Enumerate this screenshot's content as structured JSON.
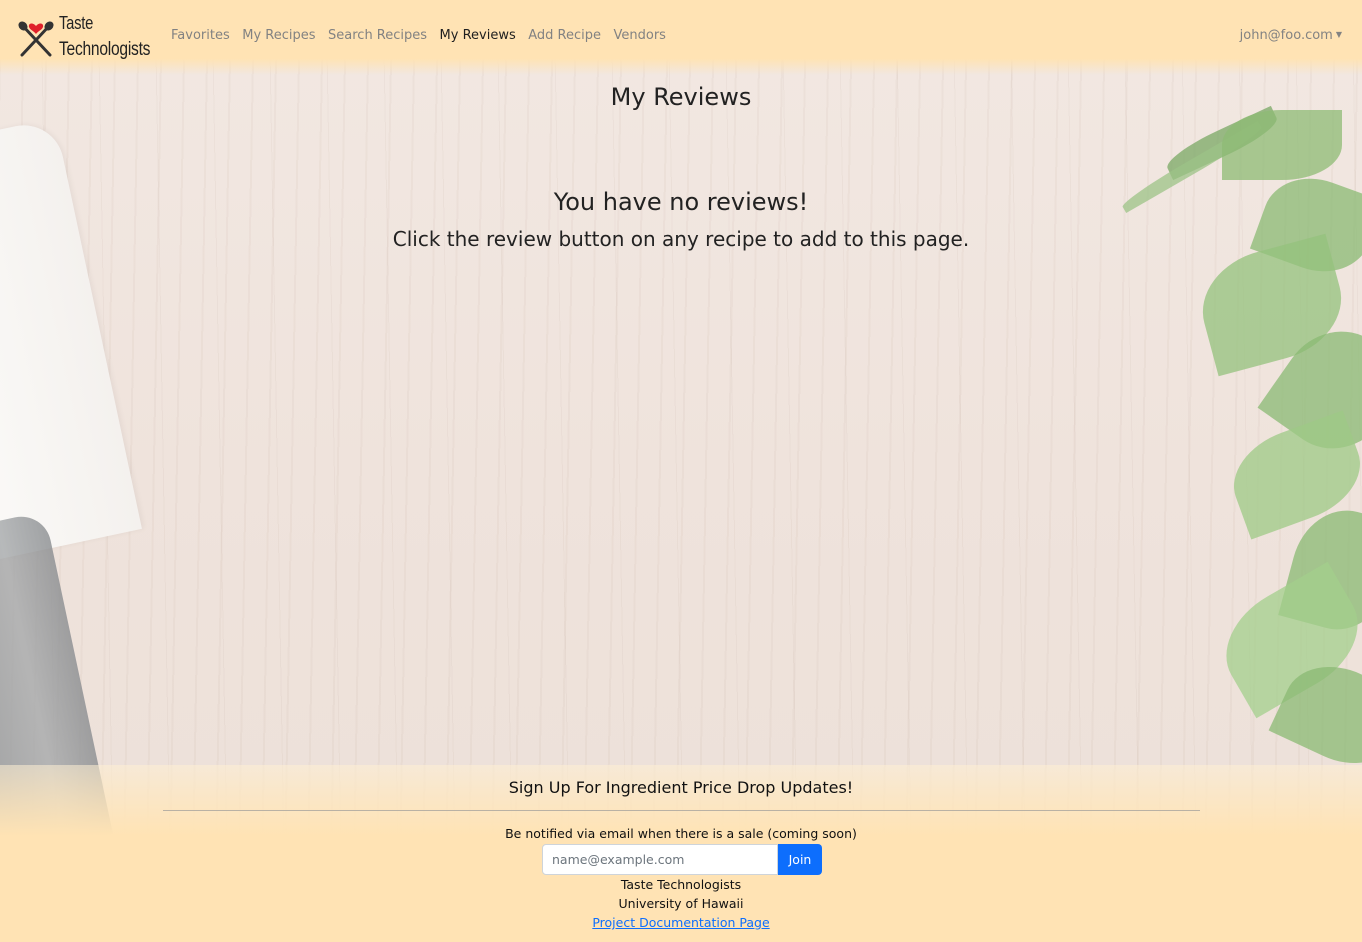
{
  "brand": {
    "line1": "Taste",
    "line2": "Technologists"
  },
  "nav": {
    "links": [
      {
        "label": "Favorites"
      },
      {
        "label": "My Recipes"
      },
      {
        "label": "Search Recipes"
      },
      {
        "label": "My Reviews",
        "active": true
      },
      {
        "label": "Add Recipe"
      },
      {
        "label": "Vendors"
      }
    ],
    "user_email": "john@foo.com"
  },
  "main": {
    "title": "My Reviews",
    "empty_heading": "You have no reviews!",
    "empty_subtext": "Click the review button on any recipe to add to this page."
  },
  "footer": {
    "signup_heading": "Sign Up For Ingredient Price Drop Updates!",
    "signup_note": "Be notified via email when there is a sale (coming soon)",
    "email_placeholder": "name@example.com",
    "join_label": "Join",
    "org_name": "Taste Technologists",
    "university": "University of Hawaii",
    "doc_link_label": "Project Documentation Page"
  },
  "colors": {
    "nav_background": "#ffe3b4",
    "primary_button": "#0d6efd",
    "heart_icon": "#e0202a",
    "link": "#0d6efd"
  }
}
